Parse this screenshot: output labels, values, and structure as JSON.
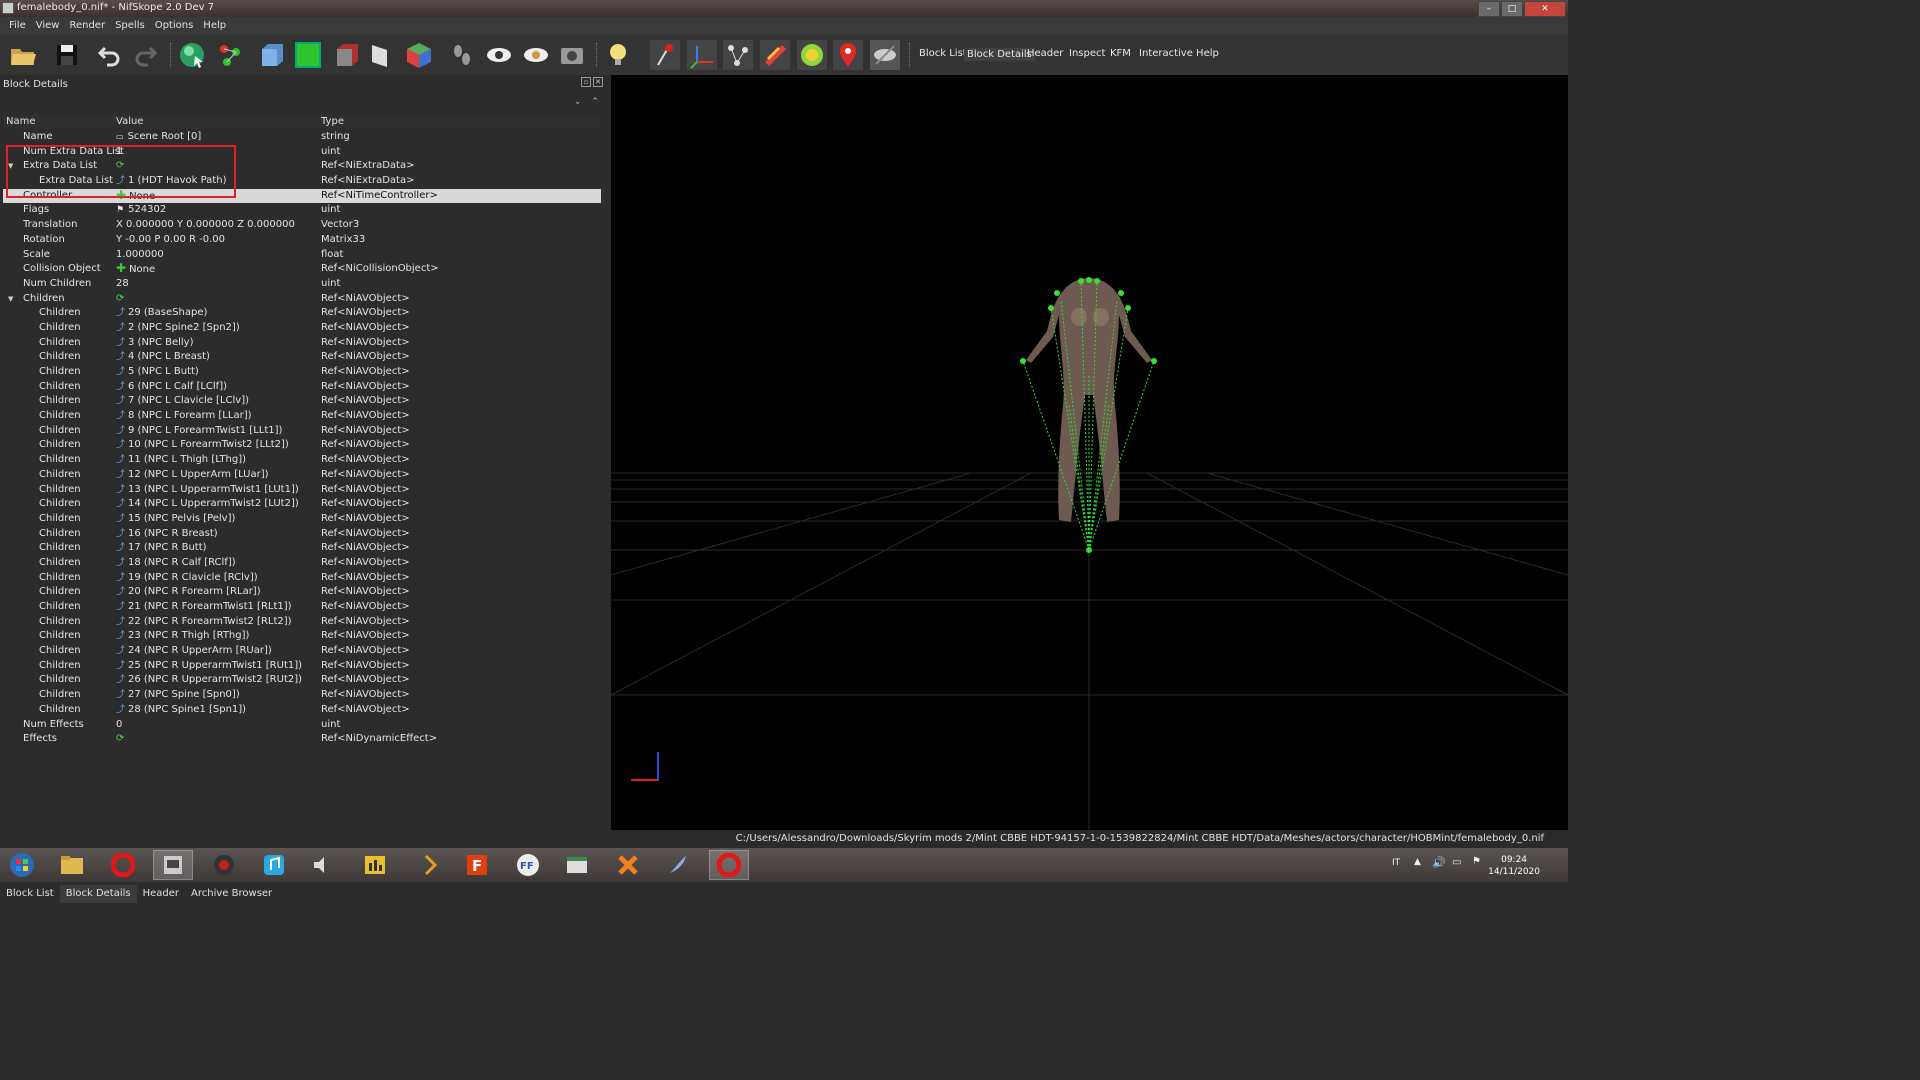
{
  "window": {
    "title": "femalebody_0.nif* - NifSkope 2.0 Dev 7"
  },
  "menu": [
    "File",
    "View",
    "Render",
    "Spells",
    "Options",
    "Help"
  ],
  "toolbar": {
    "tabs": [
      "Block List",
      "Block Details",
      "Header",
      "Inspect",
      "KFM",
      "Interactive Help"
    ]
  },
  "panel": {
    "title": "Block Details",
    "columns": {
      "name": "Name",
      "value": "Value",
      "type": "Type"
    },
    "rows": [
      {
        "name": "Name",
        "value": "Scene Root [0]",
        "type": "string",
        "indent": 0,
        "arrow": "",
        "icon": "txt"
      },
      {
        "name": "Num Extra Data List",
        "value": "1",
        "type": "uint",
        "indent": 0,
        "arrow": "",
        "icon": ""
      },
      {
        "name": "Extra Data List",
        "value": "",
        "type": "Ref<NiExtraData>",
        "indent": 0,
        "arrow": "▼",
        "icon": "rec"
      },
      {
        "name": "Extra Data List",
        "value": "1 (HDT Havok Path)",
        "type": "Ref<NiExtraData>",
        "indent": 1,
        "arrow": "",
        "icon": "link"
      },
      {
        "name": "Controller",
        "value": "None",
        "type": "Ref<NiTimeController>",
        "indent": 0,
        "arrow": "",
        "icon": "plus",
        "selected": true
      },
      {
        "name": "Flags",
        "value": "524302",
        "type": "uint",
        "indent": 0,
        "arrow": "",
        "icon": "flag"
      },
      {
        "name": "Translation",
        "value": "X 0.000000 Y 0.000000 Z 0.000000",
        "type": "Vector3",
        "indent": 0,
        "arrow": "",
        "icon": ""
      },
      {
        "name": "Rotation",
        "value": "Y -0.00 P 0.00 R -0.00",
        "type": "Matrix33",
        "indent": 0,
        "arrow": "",
        "icon": ""
      },
      {
        "name": "Scale",
        "value": "1.000000",
        "type": "float",
        "indent": 0,
        "arrow": "",
        "icon": ""
      },
      {
        "name": "Collision Object",
        "value": "None",
        "type": "Ref<NiCollisionObject>",
        "indent": 0,
        "arrow": "",
        "icon": "plus"
      },
      {
        "name": "Num Children",
        "value": "28",
        "type": "uint",
        "indent": 0,
        "arrow": "",
        "icon": ""
      },
      {
        "name": "Children",
        "value": "",
        "type": "Ref<NiAVObject>",
        "indent": 0,
        "arrow": "▼",
        "icon": "rec"
      },
      {
        "name": "Children",
        "value": "29 (BaseShape)",
        "type": "Ref<NiAVObject>",
        "indent": 1,
        "arrow": "",
        "icon": "link"
      },
      {
        "name": "Children",
        "value": "2 (NPC Spine2 [Spn2])",
        "type": "Ref<NiAVObject>",
        "indent": 1,
        "arrow": "",
        "icon": "link"
      },
      {
        "name": "Children",
        "value": "3 (NPC Belly)",
        "type": "Ref<NiAVObject>",
        "indent": 1,
        "arrow": "",
        "icon": "link"
      },
      {
        "name": "Children",
        "value": "4 (NPC L Breast)",
        "type": "Ref<NiAVObject>",
        "indent": 1,
        "arrow": "",
        "icon": "link"
      },
      {
        "name": "Children",
        "value": "5 (NPC L Butt)",
        "type": "Ref<NiAVObject>",
        "indent": 1,
        "arrow": "",
        "icon": "link"
      },
      {
        "name": "Children",
        "value": "6 (NPC L Calf [LClf])",
        "type": "Ref<NiAVObject>",
        "indent": 1,
        "arrow": "",
        "icon": "link"
      },
      {
        "name": "Children",
        "value": "7 (NPC L Clavicle [LClv])",
        "type": "Ref<NiAVObject>",
        "indent": 1,
        "arrow": "",
        "icon": "link"
      },
      {
        "name": "Children",
        "value": "8 (NPC L Forearm [LLar])",
        "type": "Ref<NiAVObject>",
        "indent": 1,
        "arrow": "",
        "icon": "link"
      },
      {
        "name": "Children",
        "value": "9 (NPC L ForearmTwist1 [LLt1])",
        "type": "Ref<NiAVObject>",
        "indent": 1,
        "arrow": "",
        "icon": "link"
      },
      {
        "name": "Children",
        "value": "10 (NPC L ForearmTwist2 [LLt2])",
        "type": "Ref<NiAVObject>",
        "indent": 1,
        "arrow": "",
        "icon": "link"
      },
      {
        "name": "Children",
        "value": "11 (NPC L Thigh [LThg])",
        "type": "Ref<NiAVObject>",
        "indent": 1,
        "arrow": "",
        "icon": "link"
      },
      {
        "name": "Children",
        "value": "12 (NPC L UpperArm [LUar])",
        "type": "Ref<NiAVObject>",
        "indent": 1,
        "arrow": "",
        "icon": "link"
      },
      {
        "name": "Children",
        "value": "13 (NPC L UpperarmTwist1 [LUt1])",
        "type": "Ref<NiAVObject>",
        "indent": 1,
        "arrow": "",
        "icon": "link"
      },
      {
        "name": "Children",
        "value": "14 (NPC L UpperarmTwist2 [LUt2])",
        "type": "Ref<NiAVObject>",
        "indent": 1,
        "arrow": "",
        "icon": "link"
      },
      {
        "name": "Children",
        "value": "15 (NPC Pelvis [Pelv])",
        "type": "Ref<NiAVObject>",
        "indent": 1,
        "arrow": "",
        "icon": "link"
      },
      {
        "name": "Children",
        "value": "16 (NPC R Breast)",
        "type": "Ref<NiAVObject>",
        "indent": 1,
        "arrow": "",
        "icon": "link"
      },
      {
        "name": "Children",
        "value": "17 (NPC R Butt)",
        "type": "Ref<NiAVObject>",
        "indent": 1,
        "arrow": "",
        "icon": "link"
      },
      {
        "name": "Children",
        "value": "18 (NPC R Calf [RClf])",
        "type": "Ref<NiAVObject>",
        "indent": 1,
        "arrow": "",
        "icon": "link"
      },
      {
        "name": "Children",
        "value": "19 (NPC R Clavicle [RClv])",
        "type": "Ref<NiAVObject>",
        "indent": 1,
        "arrow": "",
        "icon": "link"
      },
      {
        "name": "Children",
        "value": "20 (NPC R Forearm [RLar])",
        "type": "Ref<NiAVObject>",
        "indent": 1,
        "arrow": "",
        "icon": "link"
      },
      {
        "name": "Children",
        "value": "21 (NPC R ForearmTwist1 [RLt1])",
        "type": "Ref<NiAVObject>",
        "indent": 1,
        "arrow": "",
        "icon": "link"
      },
      {
        "name": "Children",
        "value": "22 (NPC R ForearmTwist2 [RLt2])",
        "type": "Ref<NiAVObject>",
        "indent": 1,
        "arrow": "",
        "icon": "link"
      },
      {
        "name": "Children",
        "value": "23 (NPC R Thigh [RThg])",
        "type": "Ref<NiAVObject>",
        "indent": 1,
        "arrow": "",
        "icon": "link"
      },
      {
        "name": "Children",
        "value": "24 (NPC R UpperArm [RUar])",
        "type": "Ref<NiAVObject>",
        "indent": 1,
        "arrow": "",
        "icon": "link"
      },
      {
        "name": "Children",
        "value": "25 (NPC R UpperarmTwist1 [RUt1])",
        "type": "Ref<NiAVObject>",
        "indent": 1,
        "arrow": "",
        "icon": "link"
      },
      {
        "name": "Children",
        "value": "26 (NPC R UpperarmTwist2 [RUt2])",
        "type": "Ref<NiAVObject>",
        "indent": 1,
        "arrow": "",
        "icon": "link"
      },
      {
        "name": "Children",
        "value": "27 (NPC Spine [Spn0])",
        "type": "Ref<NiAVObject>",
        "indent": 1,
        "arrow": "",
        "icon": "link"
      },
      {
        "name": "Children",
        "value": "28 (NPC Spine1 [Spn1])",
        "type": "Ref<NiAVObject>",
        "indent": 1,
        "arrow": "",
        "icon": "link"
      },
      {
        "name": "Num Effects",
        "value": "0",
        "type": "uint",
        "indent": 0,
        "arrow": "",
        "icon": ""
      },
      {
        "name": "Effects",
        "value": "",
        "type": "Ref<NiDynamicEffect>",
        "indent": 0,
        "arrow": "",
        "icon": "rec"
      }
    ]
  },
  "bottom_tabs": [
    "Block List",
    "Block Details",
    "Header",
    "Archive Browser"
  ],
  "status": {
    "path": "C:/Users/Alessandro/Downloads/Skyrim mods 2/Mint CBBE HDT-94157-1-0-1539822824/Mint CBBE HDT/Data/Meshes/actors/character/HOBMint/femalebody_0.nif"
  },
  "taskbar": {
    "language": "IT",
    "time": "09:24",
    "date": "14/11/2020"
  },
  "colors": {
    "accent_red": "#e0202a",
    "skeleton_green": "#33e033",
    "selected_row": "#d9d9d9"
  }
}
